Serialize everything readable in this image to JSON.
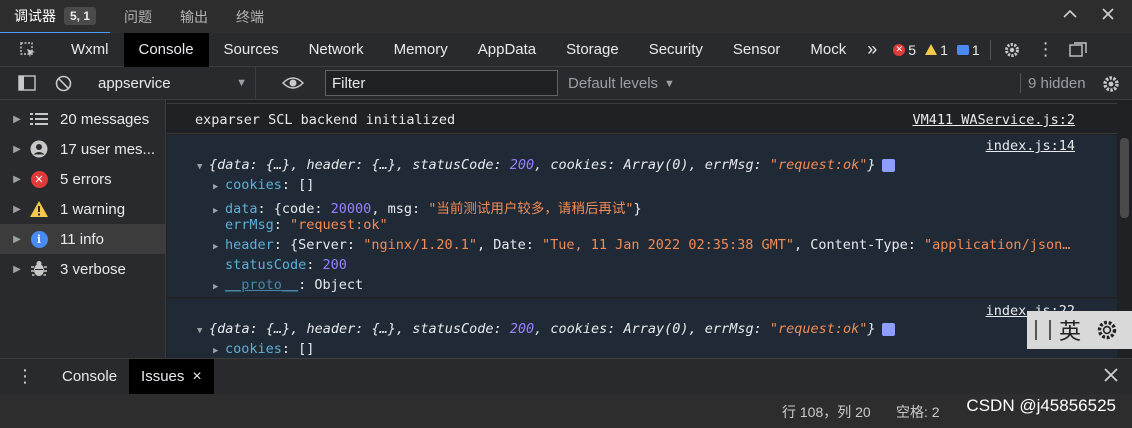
{
  "panel_tabs": {
    "debugger": "调试器",
    "badge": "5, 1",
    "issues": "问题",
    "output": "输出",
    "terminal": "终端"
  },
  "devtools_tabs": [
    "Wxml",
    "Console",
    "Sources",
    "Network",
    "Memory",
    "AppData",
    "Storage",
    "Security",
    "Sensor",
    "Mock"
  ],
  "more_tabs": "»",
  "counts": {
    "errors": "5",
    "warnings": "1",
    "messages": "1"
  },
  "filter": {
    "context": "appservice",
    "placeholder": "Filter",
    "levels": "Default levels",
    "hidden": "9 hidden"
  },
  "sidebar": [
    {
      "label": "20 messages",
      "icon": "list-icon"
    },
    {
      "label": "17 user mes...",
      "icon": "user-icon"
    },
    {
      "label": "5 errors",
      "icon": "error-icon"
    },
    {
      "label": "1 warning",
      "icon": "warning-icon"
    },
    {
      "label": "11 info",
      "icon": "info-icon"
    },
    {
      "label": "3 verbose",
      "icon": "bug-icon"
    }
  ],
  "log": {
    "line1_text": "exparser SCL backend initialized",
    "line1_src": "VM411 WAService.js:2",
    "entry_src": "index.js:14",
    "entry2_src": "index.js:22",
    "summary": {
      "open": "{data: {…}, header: {…}, statusCode: ",
      "status_code": "200",
      "mid": ", cookies: Array(0), errMsg: ",
      "errmsg": "\"request:ok\"",
      "close": "}"
    },
    "props": {
      "cookies_key": "cookies",
      "cookies_val": ": []",
      "data_key": "data",
      "data_pre": ": {code: ",
      "data_code": "20000",
      "data_mid": ", msg: ",
      "data_msg": "\"当前测试用户较多，请稍后再试\"",
      "data_close": "}",
      "errmsg_key": "errMsg",
      "errmsg_val": "\"request:ok\"",
      "header_key": "header",
      "header_pre": ": {Server: ",
      "header_server": "\"nginx/1.20.1\"",
      "header_date_key": ", Date: ",
      "header_date": "\"Tue, 11 Jan 2022 02:35:38 GMT\"",
      "header_ct_key": ", Content-Type: ",
      "header_ct": "\"application/json…",
      "statuscode_key": "statusCode",
      "statuscode_val": "200",
      "proto_key": "__proto__",
      "proto_val": ": Object"
    }
  },
  "ime": {
    "label": "英"
  },
  "drawer": {
    "console": "Console",
    "issues": "Issues",
    "close": "×"
  },
  "status": {
    "position": "行 108，列 20",
    "spaces": "空格: 2",
    "watermark": "CSDN @j45856525"
  }
}
